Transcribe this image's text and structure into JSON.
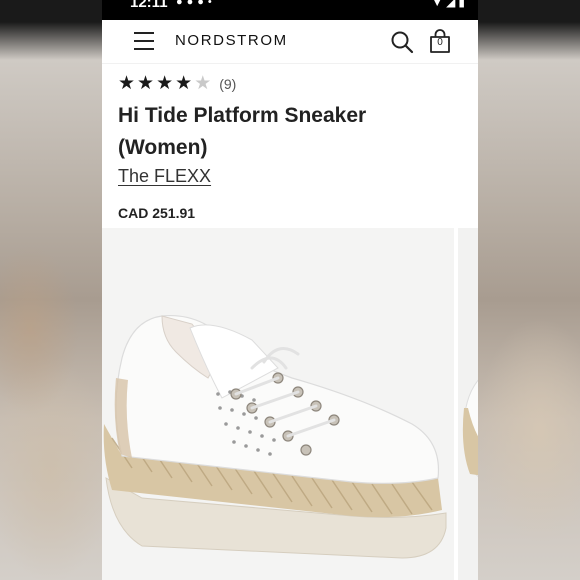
{
  "status_bar": {
    "time": "12:11"
  },
  "nav": {
    "brand": "NORDSTROM",
    "bag_count": "0",
    "menu_icon": "hamburger-menu-icon",
    "search_icon": "search-icon",
    "bag_icon": "shopping-bag-icon"
  },
  "product": {
    "rating": 4,
    "rating_max": 5,
    "review_count": "(9)",
    "title": "Hi Tide Platform Sneaker (Women)",
    "brand": "The FLEXX",
    "price": "CAD 251.91"
  },
  "gallery": {
    "image_description": "white leather platform sneaker with woven jute trim",
    "images_visible": 2
  },
  "colors": {
    "star_filled": "#1a1a1a",
    "star_empty": "#c9c9c9",
    "text": "#222222",
    "status_bar": "#000000"
  }
}
